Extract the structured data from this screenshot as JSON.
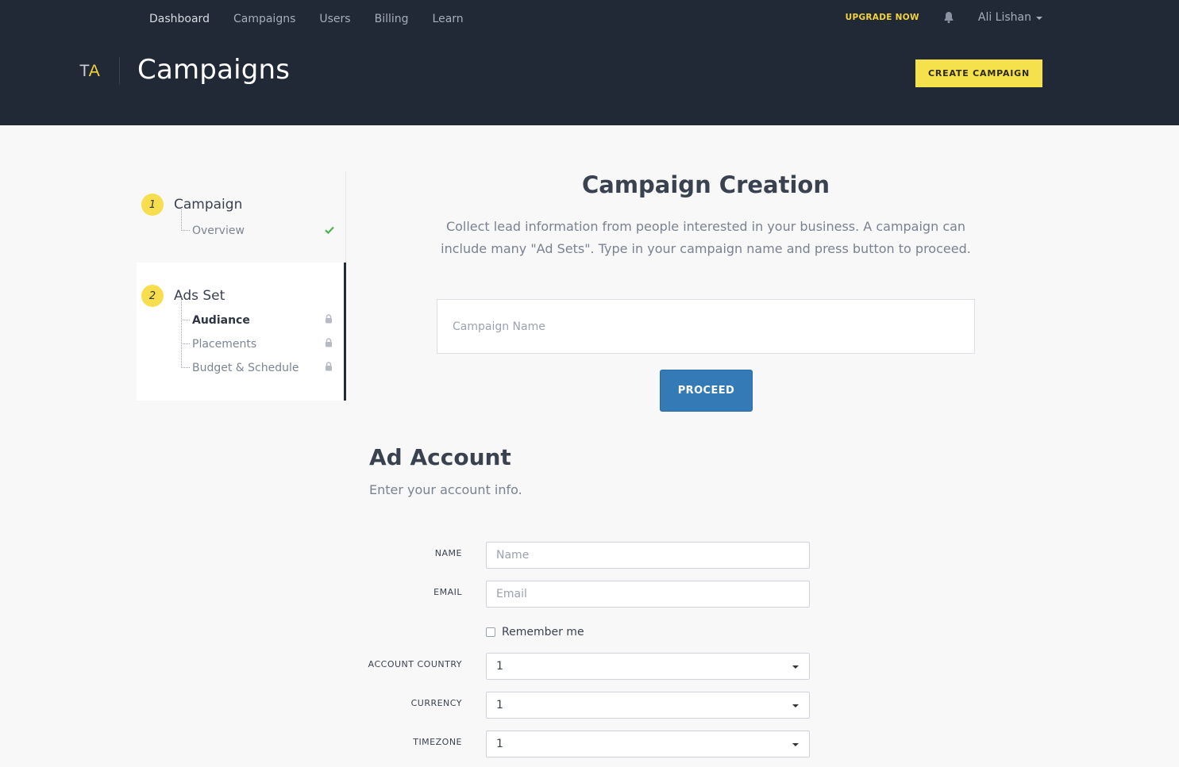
{
  "nav": {
    "items": [
      {
        "label": "Dashboard"
      },
      {
        "label": "Campaigns"
      },
      {
        "label": "Users"
      },
      {
        "label": "Billing"
      },
      {
        "label": "Learn"
      }
    ],
    "upgrade_label": "UPGRADE NOW",
    "user_name": "Ali Lishan"
  },
  "header": {
    "logo_t": "T",
    "logo_a": "A",
    "title": "Campaigns",
    "create_label": "CREATE CAMPAIGN"
  },
  "sidebar": {
    "steps": [
      {
        "number": "1",
        "title": "Campaign",
        "items": [
          {
            "label": "Overview",
            "status": "complete"
          }
        ]
      },
      {
        "number": "2",
        "title": "Ads Set",
        "items": [
          {
            "label": "Audiance",
            "status": "locked"
          },
          {
            "label": "Placements",
            "status": "locked"
          },
          {
            "label": "Budget & Schedule",
            "status": "locked"
          }
        ]
      }
    ]
  },
  "main": {
    "title": "Campaign Creation",
    "description": "Collect lead information from people interested in your business. A campaign can include many \"Ad Sets\". Type in your campaign name and press button to proceed.",
    "campaign_placeholder": "Campaign Name",
    "proceed_label": "PROCEED"
  },
  "account": {
    "title": "Ad Account",
    "subtitle": "Enter your account info.",
    "name_label": "NAME",
    "name_placeholder": "Name",
    "email_label": "EMAIL",
    "email_placeholder": "Email",
    "remember_label": "Remember me",
    "country_label": "ACCOUNT COUNTRY",
    "country_value": "1",
    "currency_label": "CURRENCY",
    "currency_value": "1",
    "timezone_label": "TIMEZONE",
    "timezone_value": "1"
  },
  "colors": {
    "header_bg": "#212836",
    "accent_yellow": "#f5e14b",
    "primary_blue": "#337ab7",
    "success_green": "#4caf50"
  }
}
